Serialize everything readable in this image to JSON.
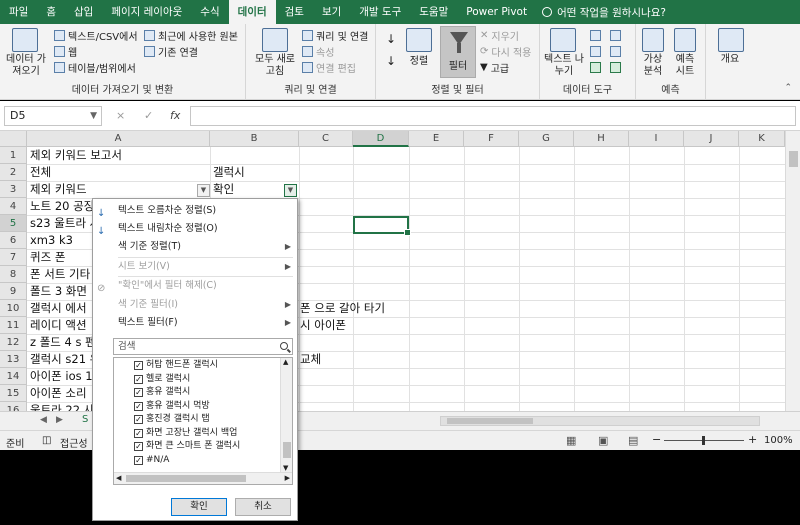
{
  "ribbon_tabs": [
    "파일",
    "홈",
    "삽입",
    "페이지 레이아웃",
    "수식",
    "데이터",
    "검토",
    "보기",
    "개발 도구",
    "도움말",
    "Power Pivot"
  ],
  "tell_me": "어떤 작업을 원하시나요?",
  "groups": {
    "get_data": {
      "big": "데이터 가져오기",
      "items": [
        "텍스트/CSV에서",
        "웹",
        "테이블/범위에서",
        "최근에 사용한 원본",
        "기존 연결"
      ],
      "label": "데이터 가져오기 및 변환"
    },
    "queries": {
      "big": "모두 새로 고침",
      "items": [
        "쿼리 및 연결",
        "속성",
        "연결 편집"
      ],
      "label": "쿼리 및 연결"
    },
    "sort_filter": {
      "sort": "정렬",
      "filter": "필터",
      "items": [
        "지우기",
        "다시 적용",
        "고급"
      ],
      "label": "정렬 및 필터"
    },
    "data_tools": {
      "big": "텍스트 나누기",
      "label": "데이터 도구"
    },
    "forecast": {
      "items": [
        "가상 분석",
        "예측 시트"
      ],
      "label": "예측"
    },
    "outline": {
      "big": "개요"
    }
  },
  "name_box": "D5",
  "fx_symbols": [
    "×",
    "✓",
    "fx"
  ],
  "columns": [
    "A",
    "B",
    "C",
    "D",
    "E",
    "F",
    "G",
    "H",
    "I",
    "J",
    "K"
  ],
  "rows": [
    "1",
    "2",
    "3",
    "4",
    "5",
    "6",
    "7",
    "8",
    "9",
    "10",
    "11",
    "12",
    "13",
    "14",
    "15",
    "16"
  ],
  "cells_a": [
    "제외 키워드 보고서",
    "전체",
    "제외 키워드",
    "노트 20 공징",
    "s23 울트라 사",
    "xm3 k3",
    "퀴즈 폰",
    "폰 서트 기타",
    "폴드 3 화면",
    "갤럭시 에서",
    "레이디 액션",
    "z 폴드 4 s 펜",
    "갤럭시 s21 유",
    "아이폰 ios 1",
    "아이폰 소리",
    "울트라 22 사"
  ],
  "cells_b": [
    "",
    "갤럭시",
    "확인"
  ],
  "overflow_texts": [
    "폰 으로 갈아 타기",
    "시 아이폰",
    "교체"
  ],
  "sheet_tab_partial": "S",
  "status": {
    "ready": "준비",
    "accessibility": "접근성",
    "zoom": "100%"
  },
  "filter_menu": {
    "items": [
      {
        "label": "텍스트 오름차순 정렬(S)",
        "dim": false
      },
      {
        "label": "텍스트 내림차순 정렬(O)",
        "dim": false
      },
      {
        "label": "색 기준 정렬(T)",
        "dim": false
      },
      {
        "label": "시트 보기(V)",
        "dim": true
      },
      {
        "label": "\"확인\"에서 필터 해제(C)",
        "dim": true
      },
      {
        "label": "색 기준 필터(I)",
        "dim": true
      },
      {
        "label": "텍스트 필터(F)",
        "dim": false
      }
    ],
    "search_placeholder": "검색",
    "list": [
      "허탑 핸드폰 갤럭시",
      "헬로 갤럭시",
      "홍유 갤럭시",
      "홍유 갤럭시 먹방",
      "홍진경 갤럭시 탭",
      "화면 고장난 갤럭시 백업",
      "화면 큰 스마트 폰 갤럭시",
      "#N/A"
    ],
    "ok": "확인",
    "cancel": "취소"
  },
  "colors": {
    "excel_green": "#217346",
    "ribbon_bg": "#f3f3f3"
  }
}
